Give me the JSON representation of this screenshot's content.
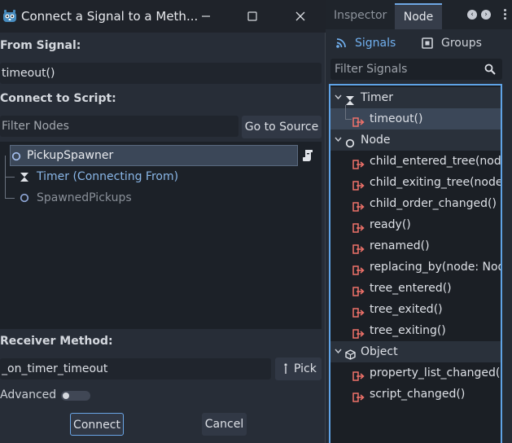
{
  "dialog": {
    "title": "Connect a Signal to a Meth...",
    "from_signal_label": "From Signal:",
    "from_signal_value": "timeout()",
    "connect_to_script_label": "Connect to Script:",
    "filter_nodes_placeholder": "Filter Nodes",
    "go_to_source_label": "Go to Source",
    "nodes": [
      {
        "label": "PickupSpawner",
        "icon": "node-circle-icon"
      },
      {
        "label": "Timer (Connecting From)",
        "icon": "hourglass-icon"
      },
      {
        "label": "SpawnedPickups",
        "icon": "node-circle-icon"
      }
    ],
    "receiver_method_label": "Receiver Method:",
    "receiver_method_value": "_on_timer_timeout",
    "pick_label": "Pick",
    "advanced_label": "Advanced",
    "advanced_on": false,
    "connect_label": "Connect",
    "cancel_label": "Cancel"
  },
  "dock": {
    "tabs": [
      "Inspector",
      "Node"
    ],
    "active_tab": "Node",
    "signals_label": "Signals",
    "groups_label": "Groups",
    "filter_placeholder": "Filter Signals",
    "timer_category": "Timer",
    "timer_signals": [
      "timeout()"
    ],
    "node_category": "Node",
    "node_signals": [
      "child_entered_tree(node:",
      "child_exiting_tree(node:",
      "child_order_changed()",
      "ready()",
      "renamed()",
      "replacing_by(node: Node",
      "tree_entered()",
      "tree_exited()",
      "tree_exiting()"
    ],
    "object_category": "Object",
    "object_signals": [
      "property_list_changed()",
      "script_changed()"
    ]
  },
  "colors": {
    "accent": "#5fa3e6",
    "signal_icon": "#f0726a",
    "timer_text": "#8ab7e8",
    "muted_text": "#8a9099"
  }
}
